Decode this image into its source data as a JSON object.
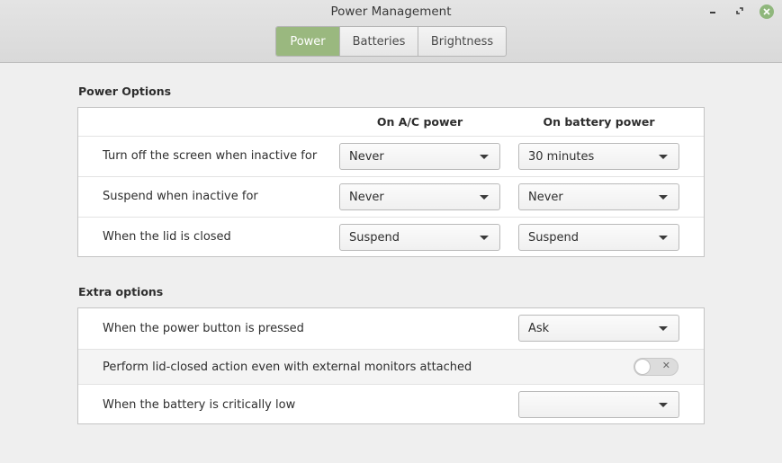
{
  "window": {
    "title": "Power Management",
    "controls": {
      "minimize": "minimize-icon",
      "maximize": "maximize-icon",
      "close": "close-icon"
    },
    "accent_color": "#9ab87f"
  },
  "tabs": [
    {
      "label": "Power",
      "active": true
    },
    {
      "label": "Batteries",
      "active": false
    },
    {
      "label": "Brightness",
      "active": false
    }
  ],
  "power_options": {
    "title": "Power Options",
    "column_ac": "On A/C power",
    "column_battery": "On battery power",
    "rows": [
      {
        "label": "Turn off the screen when inactive for",
        "ac": "Never",
        "battery": "30 minutes"
      },
      {
        "label": "Suspend when inactive for",
        "ac": "Never",
        "battery": "Never"
      },
      {
        "label": "When the lid is closed",
        "ac": "Suspend",
        "battery": "Suspend"
      }
    ]
  },
  "extra_options": {
    "title": "Extra options",
    "power_button": {
      "label": "When the power button is pressed",
      "value": "Ask"
    },
    "lid_external": {
      "label": "Perform lid-closed action even with external monitors attached",
      "enabled": false
    },
    "battery_critical": {
      "label": "When the battery is critically low",
      "value": ""
    }
  }
}
